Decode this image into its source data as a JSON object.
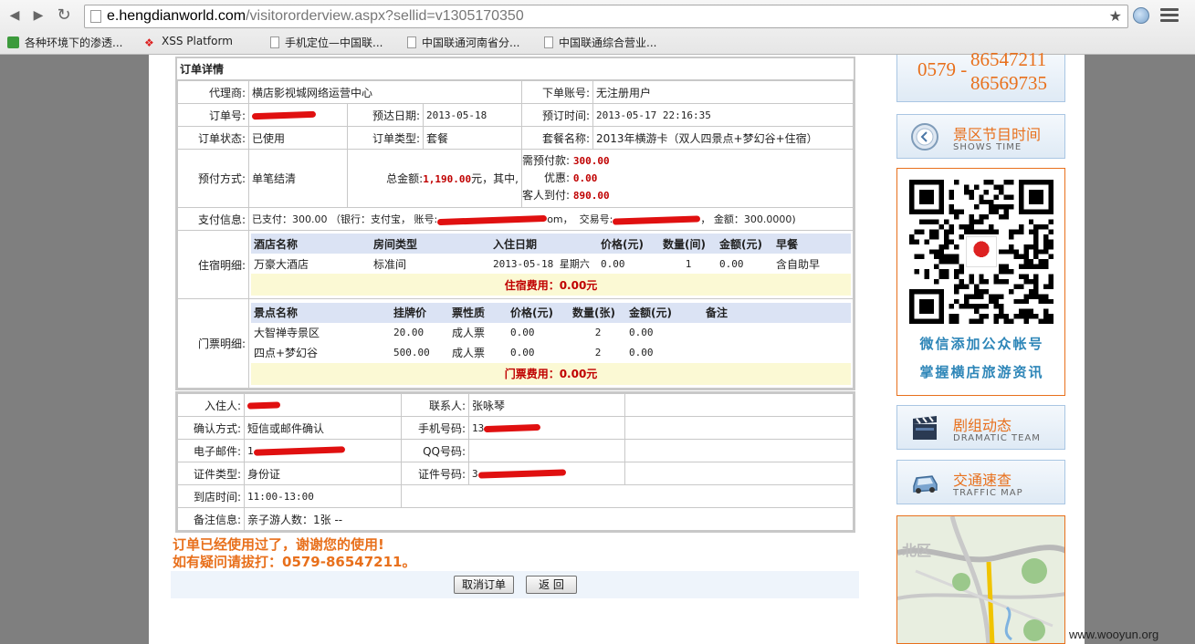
{
  "browser": {
    "url_host": "e.hengdianworld.com",
    "url_path": "/visitororderview.aspx?sellid=v1305170350",
    "bookmarks": [
      "各种环境下的渗透...",
      "XSS Platform",
      "手机定位—中国联...",
      "中国联通河南省分...",
      "中国联通综合营业..."
    ]
  },
  "order": {
    "section_title": "订单详情",
    "agent_label": "代理商:",
    "agent_value": "横店影视城网络运营中心",
    "account_label": "下单账号:",
    "account_value": "无注册用户",
    "order_no_label": "订单号:",
    "arrive_label": "预达日期:",
    "arrive_value": "2013-05-18",
    "book_time_label": "预订时间:",
    "book_time_value": "2013-05-17 22:16:35",
    "status_label": "订单状态:",
    "status_value": "已使用",
    "type_label": "订单类型:",
    "type_value": "套餐",
    "package_label": "套餐名称:",
    "package_value": "2013年横游卡（双人四景点+梦幻谷+住宿）",
    "prepay_label": "预付方式:",
    "prepay_value": "单笔结清",
    "total_prefix": "总金额:",
    "total_value": "1,190.00",
    "total_suffix": "元，其中,",
    "need_prepay_label": "需预付款:",
    "need_prepay_value": "300.00",
    "discount_label": "优惠:",
    "discount_value": "0.00",
    "guest_pay_label": "客人到付:",
    "guest_pay_value": "890.00",
    "payinfo_label": "支付信息:",
    "payinfo_paid": "已支付：300.00 （银行：支付宝，  账号:",
    "payinfo_acct_tail": "om，",
    "payinfo_trade": "交易号:",
    "payinfo_amount": "，  金额：300.0000)",
    "hotel_label": "住宿明细:",
    "hotel_headers": [
      "酒店名称",
      "房间类型",
      "入住日期",
      "价格(元)",
      "数量(间)",
      "金额(元)",
      "早餐"
    ],
    "hotel_rows": [
      [
        "万豪大酒店",
        "标准间",
        "2013-05-18 星期六",
        "0.00",
        "1",
        "0.00",
        "含自助早"
      ]
    ],
    "hotel_total": "住宿费用：0.00元",
    "ticket_label": "门票明细:",
    "ticket_headers": [
      "景点名称",
      "挂牌价",
      "票性质",
      "价格(元)",
      "数量(张)",
      "金额(元)",
      "备注"
    ],
    "ticket_rows": [
      [
        "大智禅寺景区",
        "20.00",
        "成人票",
        "0.00",
        "2",
        "0.00",
        ""
      ],
      [
        "四点+梦幻谷",
        "500.00",
        "成人票",
        "0.00",
        "2",
        "0.00",
        ""
      ]
    ],
    "ticket_total": "门票费用：0.00元"
  },
  "guest": {
    "checkin_label": "入住人:",
    "contact_label": "联系人:",
    "contact_value": "张咏琴",
    "confirm_label": "确认方式:",
    "confirm_value": "短信或邮件确认",
    "mobile_label": "手机号码:",
    "mobile_prefix": "13",
    "email_label": "电子邮件:",
    "email_prefix": "1",
    "qq_label": "QQ号码:",
    "id_type_label": "证件类型:",
    "id_type_value": "身份证",
    "id_no_label": "证件号码:",
    "id_no_prefix": "3",
    "arrive_time_label": "到店时间:",
    "arrive_time_value": "11:00-13:00",
    "remark_label": "备注信息:",
    "remark_value": "亲子游人数：1张 --"
  },
  "notice": {
    "line1": "订单已经使用过了，谢谢您的使用!",
    "line2": "如有疑问请拔打：0579-86547211。"
  },
  "buttons": {
    "cancel": "取消订单",
    "back": "返 回"
  },
  "sidebar": {
    "phone_area": "0579 -",
    "phone1": "86547211",
    "phone2": "86569735",
    "shows_cn": "景区节目时间",
    "shows_en": "SHOWS TIME",
    "qr_line1": "微信添加公众帐号",
    "qr_line2": "掌握横店旅游资讯",
    "crew_cn": "剧组动态",
    "crew_en": "DRAMATIC TEAM",
    "traffic_cn": "交通速查",
    "traffic_en": "TRAFFIC MAP",
    "map_label": "北区"
  },
  "watermark": "www.wooyun.org",
  "colors": {
    "accent_orange": "#e8701c",
    "price_red": "#c00000",
    "redaction": "#e01010"
  }
}
